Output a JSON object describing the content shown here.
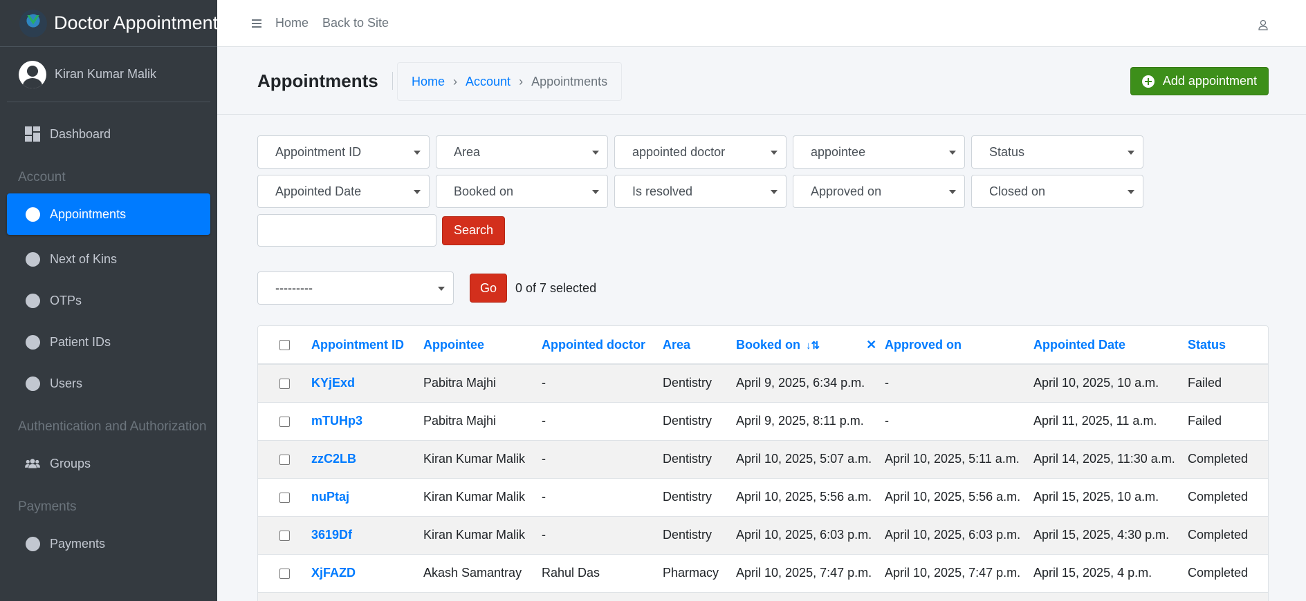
{
  "sidebar": {
    "brand_title": "Doctor Appointment",
    "user_name": "Kiran Kumar Malik",
    "dashboard_label": "Dashboard",
    "sections": [
      {
        "header": "Account",
        "items": [
          "Appointments",
          "Next of Kins",
          "OTPs",
          "Patient IDs",
          "Users"
        ]
      },
      {
        "header": "Authentication and Authorization",
        "items": [
          "Groups"
        ]
      },
      {
        "header": "Payments",
        "items": [
          "Payments"
        ]
      }
    ],
    "active_item": "Appointments"
  },
  "topbar": {
    "home_label": "Home",
    "back_label": "Back to Site"
  },
  "header": {
    "title": "Appointments",
    "breadcrumb": [
      "Home",
      "Account",
      "Appointments"
    ],
    "breadcrumb_sep": "›",
    "add_button": "Add appointment"
  },
  "filters": {
    "row1": [
      "Appointment ID",
      "Area",
      "appointed doctor",
      "appointee",
      "Status"
    ],
    "row2": [
      "Appointed Date",
      "Booked on",
      "Is resolved",
      "Approved on",
      "Closed on"
    ],
    "search_value": "",
    "search_button": "Search"
  },
  "actions": {
    "selected_action": "---------",
    "go_button": "Go",
    "selection_text": "0 of 7 selected"
  },
  "table": {
    "columns": [
      "Appointment ID",
      "Appointee",
      "Appointed doctor",
      "Area",
      "Booked on",
      "Approved on",
      "Appointed Date",
      "Status"
    ],
    "sort_indicator": "↓⇅",
    "clear_sort": "✕",
    "rows": [
      [
        "KYjExd",
        "Pabitra Majhi",
        "-",
        "Dentistry",
        "April 9, 2025, 6:34 p.m.",
        "-",
        "April 10, 2025, 10 a.m.",
        "Failed"
      ],
      [
        "mTUHp3",
        "Pabitra Majhi",
        "-",
        "Dentistry",
        "April 9, 2025, 8:11 p.m.",
        "-",
        "April 11, 2025, 11 a.m.",
        "Failed"
      ],
      [
        "zzC2LB",
        "Kiran Kumar Malik",
        "-",
        "Dentistry",
        "April 10, 2025, 5:07 a.m.",
        "April 10, 2025, 5:11 a.m.",
        "April 14, 2025, 11:30 a.m.",
        "Completed"
      ],
      [
        "nuPtaj",
        "Kiran Kumar Malik",
        "-",
        "Dentistry",
        "April 10, 2025, 5:56 a.m.",
        "April 10, 2025, 5:56 a.m.",
        "April 15, 2025, 10 a.m.",
        "Completed"
      ],
      [
        "3619Df",
        "Kiran Kumar Malik",
        "-",
        "Dentistry",
        "April 10, 2025, 6:03 p.m.",
        "April 10, 2025, 6:03 p.m.",
        "April 15, 2025, 4:30 p.m.",
        "Completed"
      ],
      [
        "XjFAZD",
        "Akash Samantray",
        "Rahul Das",
        "Pharmacy",
        "April 10, 2025, 7:47 p.m.",
        "April 10, 2025, 7:47 p.m.",
        "April 15, 2025, 4 p.m.",
        "Completed"
      ],
      [
        "",
        "",
        "",
        "",
        "",
        "",
        "",
        ""
      ]
    ]
  },
  "colors": {
    "sidebar_bg": "#343a40",
    "active_blue": "#007bff",
    "add_green": "#3d8f1a",
    "danger_red": "#d32f1c"
  }
}
